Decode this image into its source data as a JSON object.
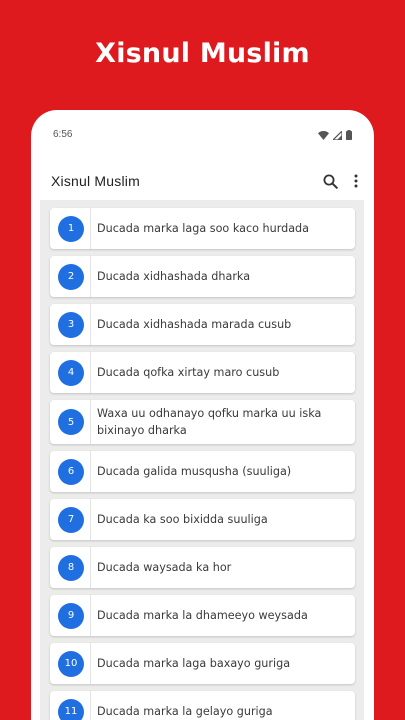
{
  "promo": {
    "title": "Xisnul Muslim"
  },
  "status_bar": {
    "time": "6:56"
  },
  "app_bar": {
    "title": "Xisnul Muslim"
  },
  "colors": {
    "background": "#de1a1f",
    "badge": "#1f6fe0"
  },
  "icons": {
    "search": "search-icon",
    "more": "more-vert-icon"
  },
  "items": [
    {
      "num": "1",
      "label": "Ducada marka laga soo kaco hurdada"
    },
    {
      "num": "2",
      "label": "Ducada xidhashada dharka"
    },
    {
      "num": "3",
      "label": "Ducada xidhashada marada cusub"
    },
    {
      "num": "4",
      "label": "Ducada qofka xirtay maro cusub"
    },
    {
      "num": "5",
      "label": "Waxa uu odhanayo qofku marka uu iska bixinayo dharka"
    },
    {
      "num": "6",
      "label": "Ducada galida musqusha (suuliga)"
    },
    {
      "num": "7",
      "label": "Ducada ka soo bixidda suuliga"
    },
    {
      "num": "8",
      "label": "Ducada waysada ka hor"
    },
    {
      "num": "9",
      "label": "Ducada marka la dhameeyo weysada"
    },
    {
      "num": "10",
      "label": "Ducada marka laga baxayo guriga"
    },
    {
      "num": "11",
      "label": "Ducada marka la gelayo guriga"
    }
  ]
}
